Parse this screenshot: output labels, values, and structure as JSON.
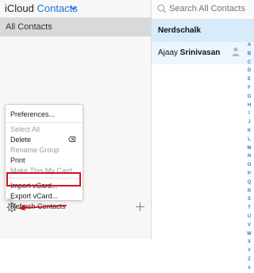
{
  "header": {
    "brand": "iCloud",
    "section": "Contacts"
  },
  "groups": [
    {
      "label": "All Contacts"
    }
  ],
  "search": {
    "placeholder": "Search All Contacts"
  },
  "contacts": [
    {
      "name": "Nerdschalk",
      "selected": true
    },
    {
      "first": "Ajaay",
      "last": "Srinivasan",
      "selected": false
    }
  ],
  "alphabet": [
    "A",
    "B",
    "C",
    "D",
    "E",
    "F",
    "G",
    "H",
    "I",
    "J",
    "K",
    "L",
    "M",
    "N",
    "O",
    "P",
    "Q",
    "R",
    "S",
    "T",
    "U",
    "V",
    "W",
    "X",
    "Y",
    "Z",
    "#"
  ],
  "menu": {
    "preferences": "Preferences...",
    "select_all": "Select All",
    "delete": "Delete",
    "rename_group": "Rename Group",
    "print": "Print",
    "make_my_card": "Make This My Card",
    "import_vcard": "Import vCard...",
    "export_vcard": "Export vCard...",
    "refresh_contacts": "Refresh Contacts"
  },
  "colors": {
    "accent": "#1b76d6",
    "highlight_box": "#d3141b",
    "selected_row": "#d7ebfb"
  }
}
